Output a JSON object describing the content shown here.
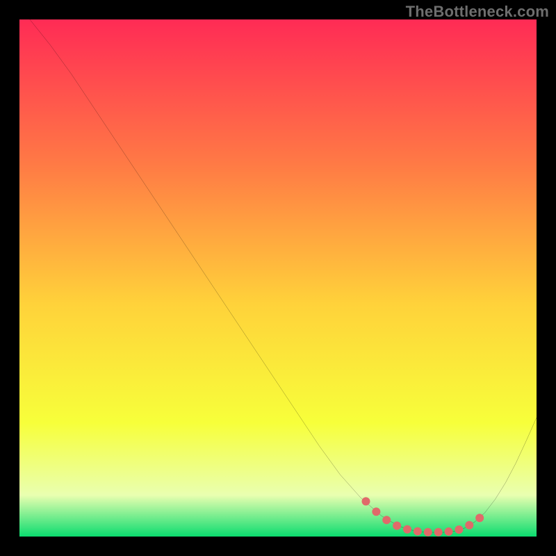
{
  "watermark": "TheBottleneck.com",
  "chart_data": {
    "type": "line",
    "title": "",
    "xlabel": "",
    "ylabel": "",
    "xlim": [
      0,
      100
    ],
    "ylim": [
      0,
      100
    ],
    "grid": false,
    "legend": false,
    "background_gradient": {
      "top_color": "#ff2b55",
      "upper_mid_color": "#ff7a45",
      "mid_color": "#ffd23a",
      "lower_mid_color": "#f7ff3a",
      "near_bottom_color": "#e9ffb0",
      "bottom_color": "#0bdc6f"
    },
    "series": [
      {
        "name": "main-curve",
        "stroke": "#000000",
        "stroke_width": 1.6,
        "x": [
          2,
          6,
          10,
          14,
          18,
          22,
          26,
          30,
          34,
          38,
          42,
          46,
          50,
          54,
          58,
          62,
          66,
          70,
          72,
          74,
          76,
          78,
          80,
          82,
          84,
          86,
          88,
          90,
          92,
          94,
          96,
          98,
          100
        ],
        "y": [
          100,
          95,
          89.5,
          83.5,
          77.5,
          71.5,
          65.5,
          59.5,
          53.5,
          47.5,
          41.5,
          35.5,
          29.5,
          23.5,
          17.5,
          12,
          7.5,
          4,
          2.8,
          1.8,
          1.2,
          0.9,
          0.8,
          0.8,
          1.0,
          1.6,
          2.8,
          4.6,
          7.2,
          10.4,
          14.2,
          18.5,
          23
        ]
      },
      {
        "name": "highlight-dots",
        "type": "scatter",
        "color": "#e06a6a",
        "marker_size": 12,
        "x": [
          67,
          69,
          71,
          73,
          75,
          77,
          79,
          81,
          83,
          85,
          87,
          89
        ],
        "y": [
          6.8,
          4.8,
          3.2,
          2.1,
          1.4,
          1.0,
          0.85,
          0.85,
          0.95,
          1.35,
          2.2,
          3.6
        ]
      }
    ]
  }
}
